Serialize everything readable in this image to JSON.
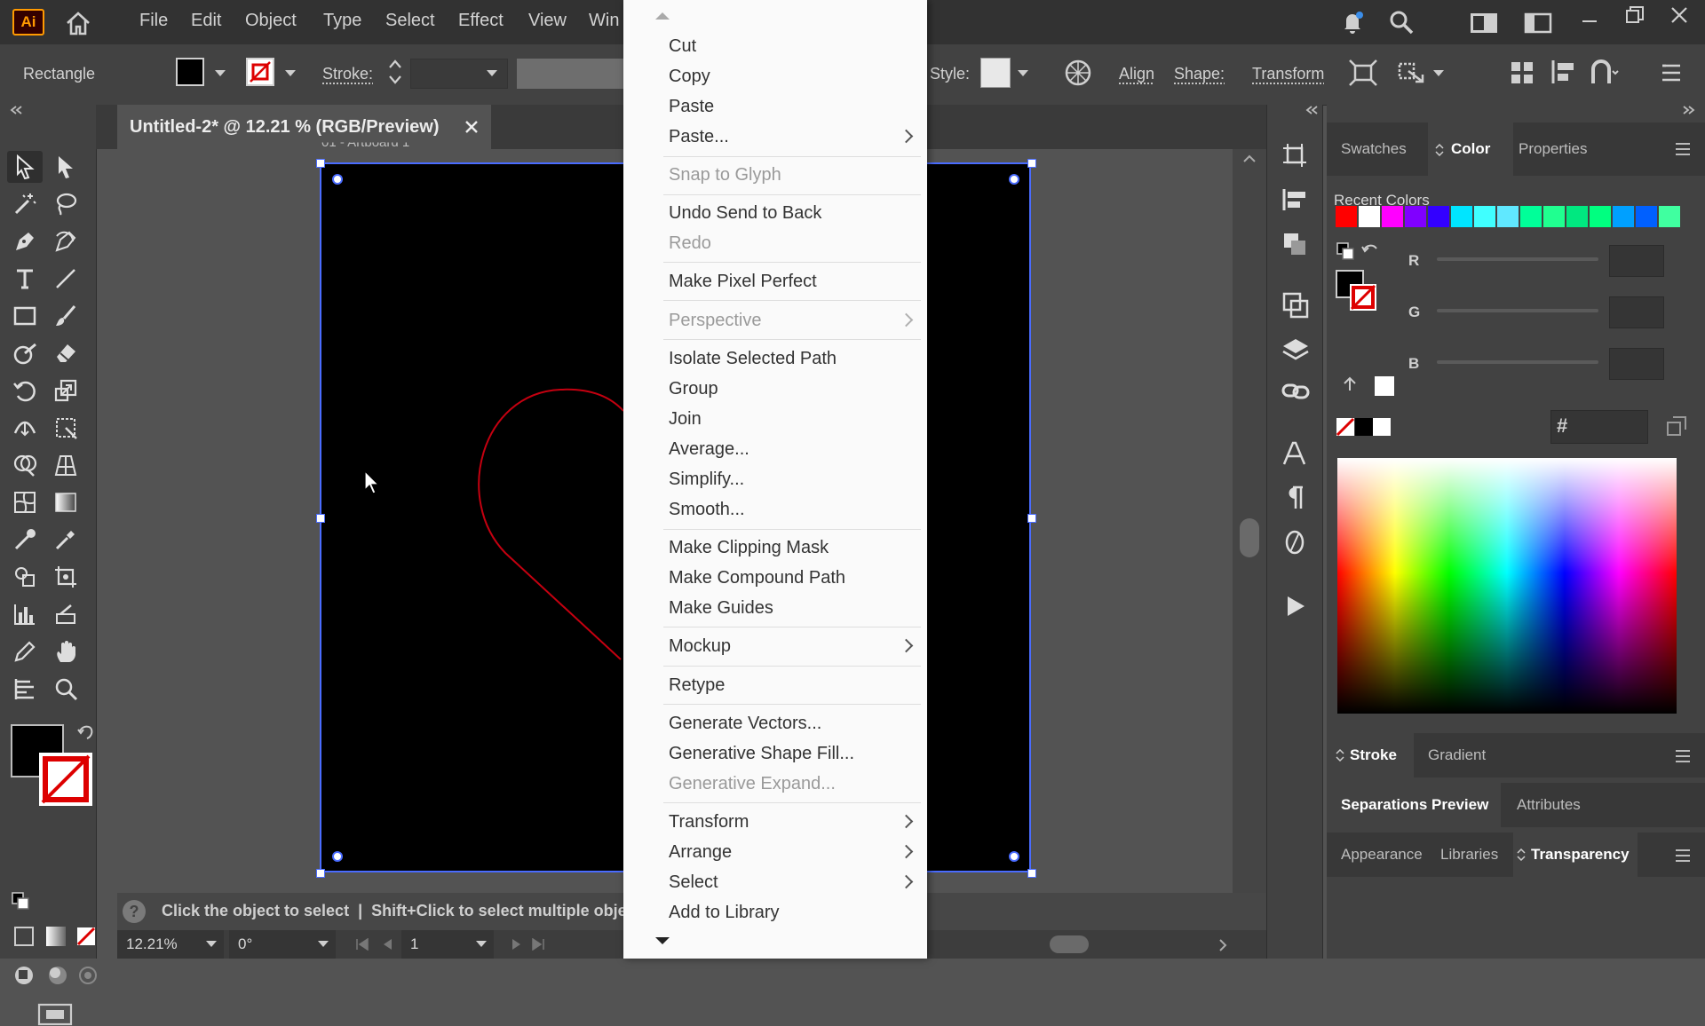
{
  "app": {
    "logo": "Ai",
    "menus": [
      "File",
      "Edit",
      "Object",
      "Type",
      "Select",
      "Effect",
      "View",
      "Win"
    ]
  },
  "control": {
    "tool_name": "Rectangle",
    "stroke_label": "Stroke:",
    "style_label": "Style:",
    "align_label": "Align",
    "shape_label": "Shape:",
    "transform_label": "Transform"
  },
  "document": {
    "tab_title": "Untitled-2* @ 12.21 % (RGB/Preview)",
    "artboard_label": "01 - Artboard 1"
  },
  "status": {
    "hint": "Click the object to select  |  Shift+Click to select multiple object",
    "zoom": "12.21%",
    "rotation": "0°",
    "artboard_number": "1"
  },
  "panels": {
    "top_tabs": [
      "Swatches",
      "Color",
      "Properties"
    ],
    "active_top_tab": "Color",
    "recent_colors_label": "Recent Colors",
    "recent_colors": [
      "#ff0000",
      "#ffffff",
      "#ff00ff",
      "#8000ff",
      "#3300ff",
      "#00e5ff",
      "#40ffff",
      "#60e8ff",
      "#00ff99",
      "#20ff90",
      "#00e880",
      "#00ff80",
      "#00a0ff",
      "#0060ff",
      "#40ffa0"
    ],
    "channels": [
      "R",
      "G",
      "B"
    ],
    "hex_label": "#",
    "stroke_tab": "Stroke",
    "gradient_tab": "Gradient",
    "separations_tab": "Separations Preview",
    "attributes_tab": "Attributes",
    "appearance_tab": "Appearance",
    "libraries_tab": "Libraries",
    "transparency_tab": "Transparency"
  },
  "context_menu": {
    "cut": "Cut",
    "copy": "Copy",
    "paste": "Paste",
    "paste_more": "Paste...",
    "snap_to_glyph": "Snap to Glyph",
    "undo": "Undo Send to Back",
    "redo": "Redo",
    "pixel_perfect": "Make Pixel Perfect",
    "perspective": "Perspective",
    "isolate": "Isolate Selected Path",
    "group": "Group",
    "join": "Join",
    "average": "Average...",
    "simplify": "Simplify...",
    "smooth": "Smooth...",
    "clipping_mask": "Make Clipping Mask",
    "compound_path": "Make Compound Path",
    "guides": "Make Guides",
    "mockup": "Mockup",
    "retype": "Retype",
    "generate_vectors": "Generate Vectors...",
    "generative_shape_fill": "Generative Shape Fill...",
    "generative_expand": "Generative Expand...",
    "transform": "Transform",
    "arrange": "Arrange",
    "select": "Select",
    "add_to_library": "Add to Library"
  },
  "colors": {
    "accent": "#ff9a00",
    "selection": "#4a6cff",
    "path": "#c40010"
  }
}
